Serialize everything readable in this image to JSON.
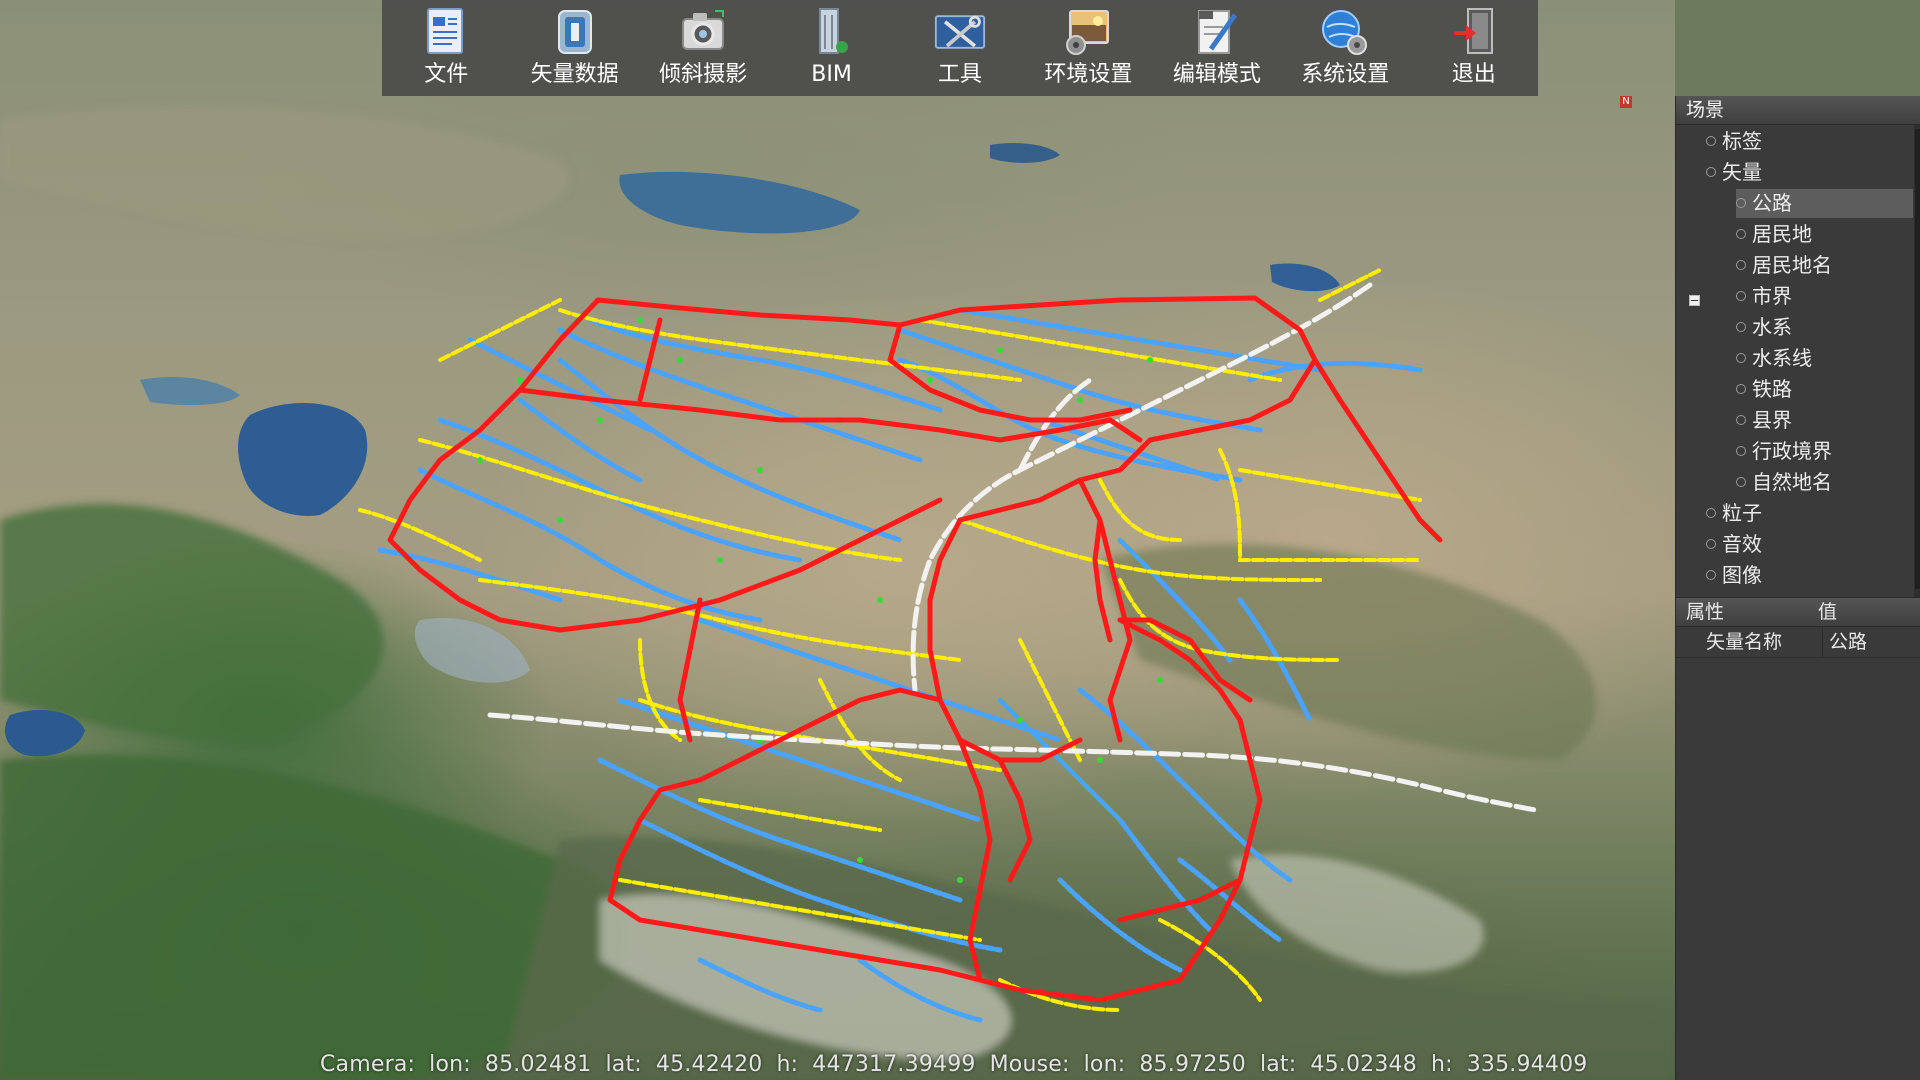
{
  "toolbar": {
    "items": [
      {
        "label": "文件",
        "icon": "document-icon"
      },
      {
        "label": "矢量数据",
        "icon": "vector-data-icon"
      },
      {
        "label": "倾斜摄影",
        "icon": "camera-icon"
      },
      {
        "label": "BIM",
        "icon": "building-icon"
      },
      {
        "label": "工具",
        "icon": "tools-icon"
      },
      {
        "label": "环境设置",
        "icon": "environment-icon"
      },
      {
        "label": "编辑模式",
        "icon": "edit-icon"
      },
      {
        "label": "系统设置",
        "icon": "globe-gear-icon"
      },
      {
        "label": "退出",
        "icon": "exit-icon"
      }
    ]
  },
  "scene_panel": {
    "title": "场景",
    "tree": [
      {
        "label": "标签",
        "level": 0
      },
      {
        "label": "矢量",
        "level": 0,
        "expanded": true
      },
      {
        "label": "公路",
        "level": 1,
        "selected": true
      },
      {
        "label": "居民地",
        "level": 1
      },
      {
        "label": "居民地名",
        "level": 1
      },
      {
        "label": "市界",
        "level": 1
      },
      {
        "label": "水系",
        "level": 1
      },
      {
        "label": "水系线",
        "level": 1
      },
      {
        "label": "铁路",
        "level": 1
      },
      {
        "label": "县界",
        "level": 1
      },
      {
        "label": "行政境界",
        "level": 1
      },
      {
        "label": "自然地名",
        "level": 1
      },
      {
        "label": "粒子",
        "level": 0
      },
      {
        "label": "音效",
        "level": 0
      },
      {
        "label": "图像",
        "level": 0
      }
    ]
  },
  "properties": {
    "header_property": "属性",
    "header_value": "值",
    "rows": [
      {
        "property": "矢量名称",
        "value": "公路"
      }
    ]
  },
  "status": {
    "camera_label": "Camera:",
    "camera_lon_label": "lon:",
    "camera_lon": "85.02481",
    "camera_lat_label": "lat:",
    "camera_lat": "45.42420",
    "camera_h_label": "h:",
    "camera_h": "447317.39499",
    "mouse_label": "Mouse:",
    "mouse_lon_label": "lon:",
    "mouse_lon": "85.97250",
    "mouse_lat_label": "lat:",
    "mouse_lat": "45.02348",
    "mouse_h_label": "h:",
    "mouse_h": "335.94409"
  },
  "map": {
    "compass_label": "N",
    "colors": {
      "boundary": "#ff1a1a",
      "road": "#ffee00",
      "water_line": "#4aa3ff",
      "railway": "#f2f2f2",
      "settlement": "#33dd33",
      "lake": "#2f5f95"
    }
  }
}
